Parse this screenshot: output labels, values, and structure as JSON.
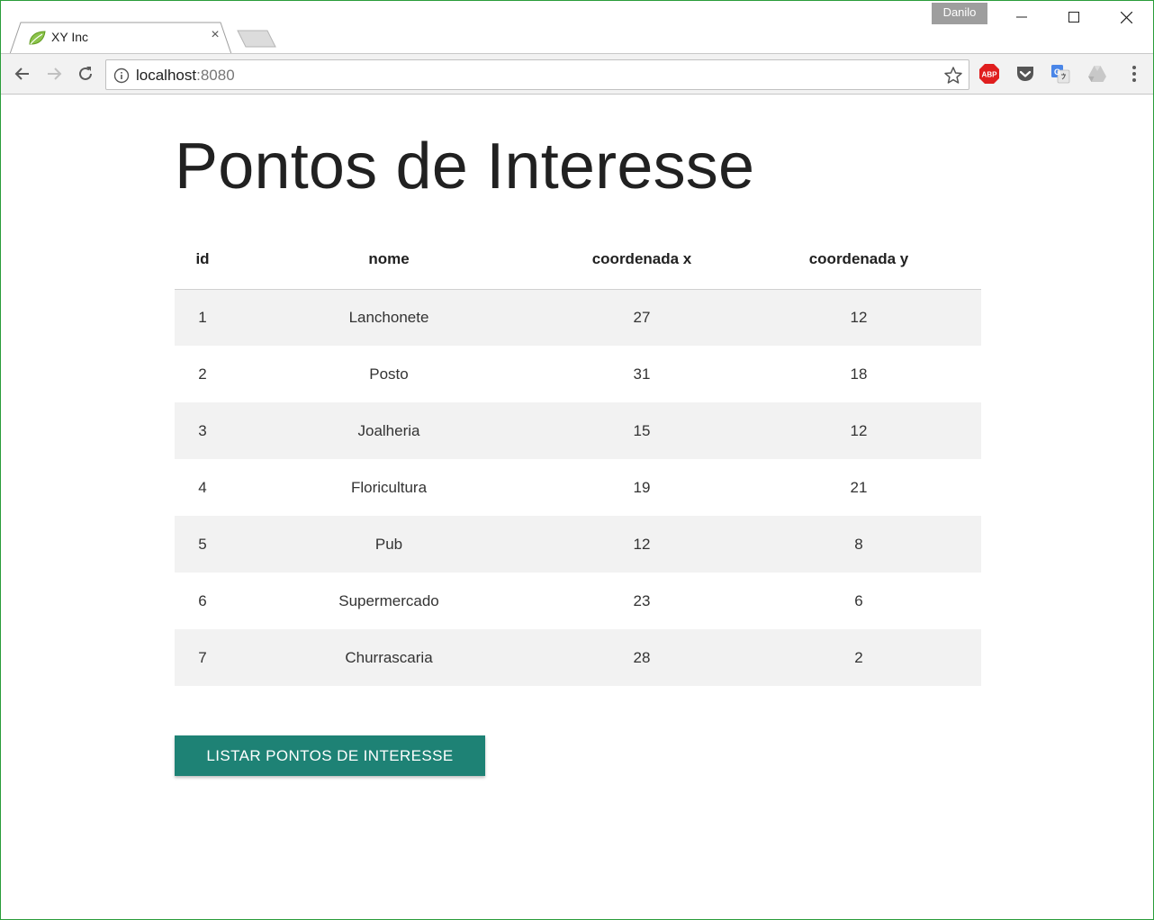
{
  "browser": {
    "tab_title": "XY Inc",
    "tab_close": "×",
    "profile_name": "Danilo",
    "address_host": "localhost",
    "address_port": ":8080",
    "extensions": [
      "adblock-plus-icon",
      "pocket-icon",
      "google-translate-icon",
      "google-drive-icon"
    ],
    "adblock_label": "ABP"
  },
  "page": {
    "title": "Pontos de Interesse",
    "table": {
      "headers": {
        "id": "id",
        "nome": "nome",
        "x": "coordenada x",
        "y": "coordenada y"
      },
      "rows": [
        {
          "id": "1",
          "nome": "Lanchonete",
          "x": "27",
          "y": "12"
        },
        {
          "id": "2",
          "nome": "Posto",
          "x": "31",
          "y": "18"
        },
        {
          "id": "3",
          "nome": "Joalheria",
          "x": "15",
          "y": "12"
        },
        {
          "id": "4",
          "nome": "Floricultura",
          "x": "19",
          "y": "21"
        },
        {
          "id": "5",
          "nome": "Pub",
          "x": "12",
          "y": "8"
        },
        {
          "id": "6",
          "nome": "Supermercado",
          "x": "23",
          "y": "6"
        },
        {
          "id": "7",
          "nome": "Churrascaria",
          "x": "28",
          "y": "2"
        }
      ]
    },
    "list_button_label": "LISTAR PONTOS DE INTERESSE"
  },
  "colors": {
    "button_bg": "#1e8275",
    "row_stripe": "#f2f2f2",
    "window_border": "#2a9d3a"
  }
}
